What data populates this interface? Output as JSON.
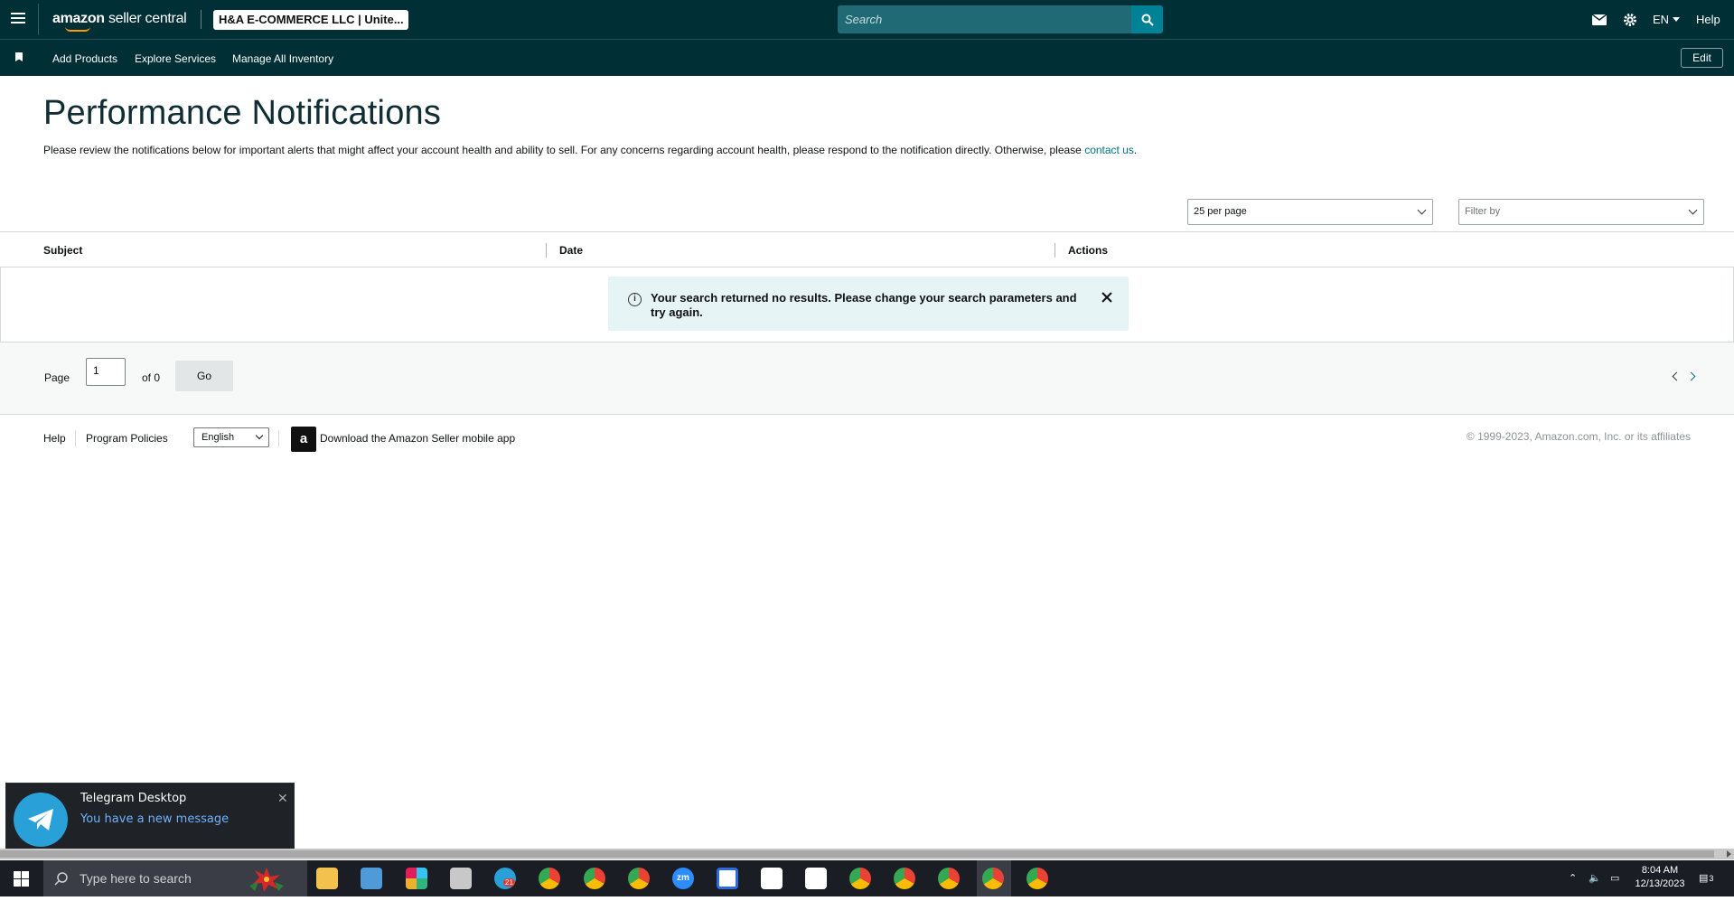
{
  "topbar": {
    "logo_part1": "amazon",
    "logo_part2": "seller central",
    "account": "H&A E-COMMERCE LLC | Unite...",
    "search_placeholder": "Search",
    "language": "EN",
    "help": "Help"
  },
  "subnav": {
    "items": [
      "Add Products",
      "Explore Services",
      "Manage All Inventory"
    ],
    "edit": "Edit"
  },
  "page": {
    "title": "Performance Notifications",
    "description": "Please review the notifications below for important alerts that might affect your account health and ability to sell. For any concerns regarding account health, please respond to the notification directly. Otherwise, please",
    "contact_link": "contact us",
    "description_end": ".",
    "per_page": "25 per page",
    "filter_placeholder": "Filter by"
  },
  "table": {
    "columns": [
      "Subject",
      "Date",
      "Actions"
    ],
    "empty_message": "Your search returned no results. Please change your search parameters and try again."
  },
  "pager": {
    "page_label": "Page",
    "current_page": "1",
    "of_label": "of 0",
    "go": "Go"
  },
  "footer": {
    "help": "Help",
    "program_policies": "Program Policies",
    "language": "English",
    "download_app": "Download the Amazon Seller mobile app",
    "copyright": "© 1999-2023, Amazon.com, Inc. or its affiliates"
  },
  "toast": {
    "title": "Telegram Desktop",
    "message": "You have a new message",
    "close": "✕"
  },
  "taskbar": {
    "search_placeholder": "Type here to search",
    "time": "8:04 AM",
    "date": "12/13/2023",
    "telegram_badge": "21",
    "notification_count": "3"
  },
  "colors": {
    "topbar": "#002f36",
    "search_button": "#008296",
    "link": "#007185",
    "alert_bg": "#e7f4f5"
  }
}
